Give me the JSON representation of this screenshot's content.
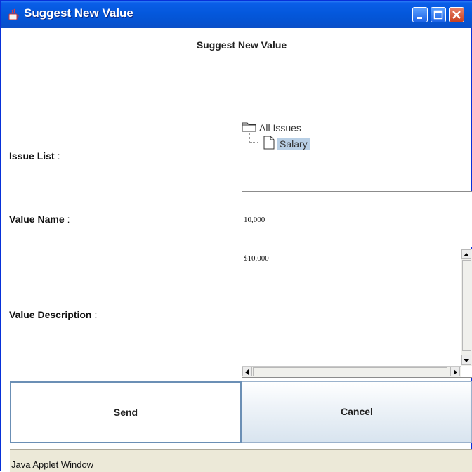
{
  "window": {
    "title": "Suggest New Value"
  },
  "dialog": {
    "heading": "Suggest New Value",
    "issue_list_label": "Issue List",
    "value_name_label": "Value Name",
    "value_description_label": "Value Description",
    "colon": ":",
    "tree": {
      "root": "All Issues",
      "child": "Salary"
    },
    "value_name": "10,000",
    "value_description": "$10,000"
  },
  "buttons": {
    "send": "Send",
    "cancel": "Cancel"
  },
  "status": {
    "text": "Java Applet Window"
  },
  "icons": {
    "app": "java-cup-icon",
    "minimize": "minimize-icon",
    "maximize": "maximize-icon",
    "close": "close-icon",
    "folder": "folder-icon",
    "document": "document-icon"
  },
  "colors": {
    "titlebar": "#0458dc",
    "selection": "#b8cfe5",
    "status_bg": "#ece9d8"
  }
}
